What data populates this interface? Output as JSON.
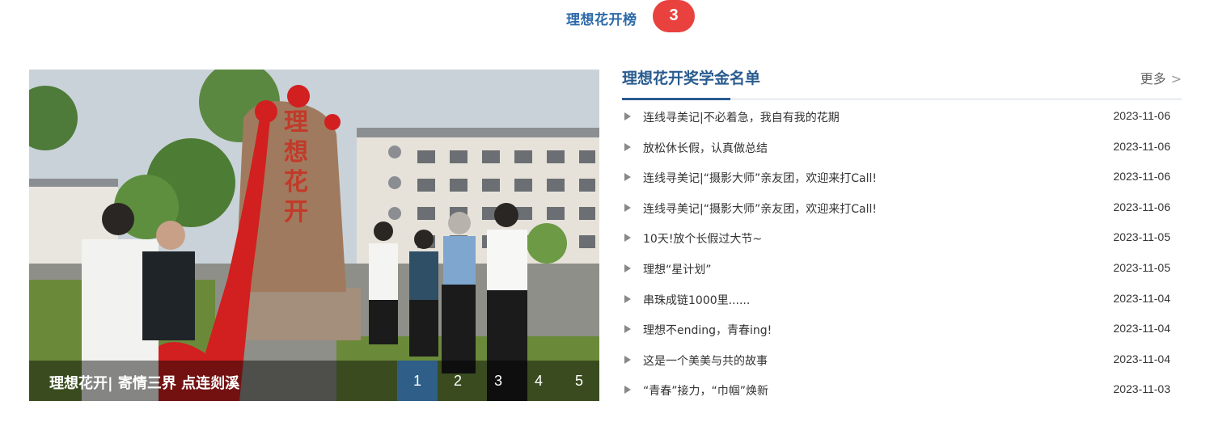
{
  "header": {
    "title": "理想花开榜",
    "badge": "3",
    "badge_color": "#e8413e",
    "accent_color": "#2c6aa8"
  },
  "slider": {
    "caption": "理想花开| 寄情三界 点连剡溪",
    "stone_text": [
      "理",
      "想",
      "花",
      "开"
    ],
    "pages": [
      "1",
      "2",
      "3",
      "4",
      "5"
    ],
    "active_page": "1",
    "active_color": "#2f5f88"
  },
  "news": {
    "title": "理想花开奖学金名单",
    "more_label": "更多",
    "more_icon": "chevron-right-icon",
    "items": [
      {
        "title": "连线寻美记|不必着急，我自有我的花期",
        "date": "2023-11-06"
      },
      {
        "title": "放松休长假，认真做总结",
        "date": "2023-11-06"
      },
      {
        "title": "连线寻美记|“摄影大师”亲友团，欢迎来打Call!",
        "date": "2023-11-06"
      },
      {
        "title": "连线寻美记|“摄影大师”亲友团，欢迎来打Call!",
        "date": "2023-11-06"
      },
      {
        "title": "10天!放个长假过大节~",
        "date": "2023-11-05"
      },
      {
        "title": "理想“星计划”",
        "date": "2023-11-05"
      },
      {
        "title": "串珠成链1000里......",
        "date": "2023-11-04"
      },
      {
        "title": "理想不ending，青春ing!",
        "date": "2023-11-04"
      },
      {
        "title": "这是一个美美与共的故事",
        "date": "2023-11-04"
      },
      {
        "title": "“青春”接力，“巾帼”焕新",
        "date": "2023-11-03"
      }
    ]
  }
}
